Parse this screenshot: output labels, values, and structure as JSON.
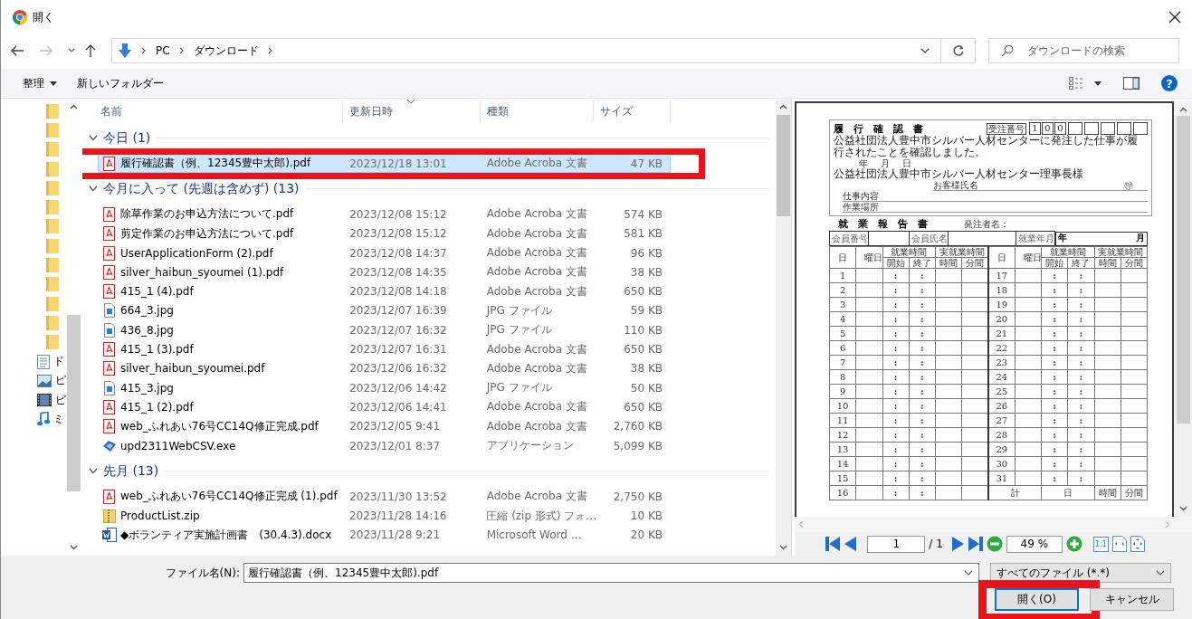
{
  "window": {
    "title": "開く"
  },
  "navigation": {
    "path": [
      "PC",
      "ダウンロード"
    ],
    "search": {
      "placeholder": "ダウンロードの検索"
    }
  },
  "toolbar": {
    "organize": "整理",
    "new_folder": "新しいフォルダー",
    "help": "?"
  },
  "nav_pane": {
    "items": [
      {
        "kind": "folder"
      },
      {
        "kind": "folder"
      },
      {
        "kind": "folder"
      },
      {
        "kind": "folder"
      },
      {
        "kind": "folder"
      },
      {
        "kind": "folder"
      },
      {
        "kind": "folder"
      },
      {
        "kind": "folder"
      },
      {
        "kind": "folder"
      },
      {
        "kind": "folder"
      },
      {
        "kind": "folder"
      },
      {
        "kind": "folder"
      },
      {
        "kind": "folder"
      },
      {
        "kind": "documents",
        "label": "ド"
      },
      {
        "kind": "pictures",
        "label": "ピ"
      },
      {
        "kind": "videos",
        "label": "ビ"
      },
      {
        "kind": "music",
        "label": "ミ"
      }
    ]
  },
  "file_list": {
    "columns": [
      {
        "label": "名前",
        "sorted": false
      },
      {
        "label": "更新日時",
        "sorted": true
      },
      {
        "label": "種類",
        "sorted": false
      },
      {
        "label": "サイズ",
        "sorted": false
      }
    ],
    "groups": [
      {
        "label": "今日 (1)",
        "expanded": true,
        "files": [
          {
            "kind": "pdf",
            "name": "履行確認書（例、12345豊中太郎).pdf",
            "modified": "2023/12/18 13:01",
            "type": "Adobe Acroba 文書",
            "size": "47 KB",
            "selected": true,
            "highlighted": true
          }
        ]
      },
      {
        "label": "今月に入って (先週は含めず) (13)",
        "expanded": true,
        "files": [
          {
            "kind": "pdf",
            "name": "除草作業のお申込方法について.pdf",
            "modified": "2023/12/08 15:12",
            "type": "Adobe Acroba 文書",
            "size": "574 KB",
            "selected": false,
            "highlighted": false
          },
          {
            "kind": "pdf",
            "name": "剪定作業のお申込方法について.pdf",
            "modified": "2023/12/08 15:12",
            "type": "Adobe Acroba 文書",
            "size": "581 KB",
            "selected": false,
            "highlighted": false
          },
          {
            "kind": "pdf",
            "name": "UserApplicationForm (2).pdf",
            "modified": "2023/12/08 14:37",
            "type": "Adobe Acroba 文書",
            "size": "96 KB",
            "selected": false,
            "highlighted": false
          },
          {
            "kind": "pdf",
            "name": "silver_haibun_syoumei (1).pdf",
            "modified": "2023/12/08 14:35",
            "type": "Adobe Acroba 文書",
            "size": "38 KB",
            "selected": false,
            "highlighted": false
          },
          {
            "kind": "pdf",
            "name": "415_1 (4).pdf",
            "modified": "2023/12/08 14:18",
            "type": "Adobe Acroba 文書",
            "size": "650 KB",
            "selected": false,
            "highlighted": false
          },
          {
            "kind": "jpg",
            "name": "664_3.jpg",
            "modified": "2023/12/07 16:39",
            "type": "JPG ファイル",
            "size": "59 KB",
            "selected": false,
            "highlighted": false
          },
          {
            "kind": "jpg",
            "name": "436_8.jpg",
            "modified": "2023/12/07 16:32",
            "type": "JPG ファイル",
            "size": "110 KB",
            "selected": false,
            "highlighted": false
          },
          {
            "kind": "pdf",
            "name": "415_1 (3).pdf",
            "modified": "2023/12/07 16:31",
            "type": "Adobe Acroba 文書",
            "size": "650 KB",
            "selected": false,
            "highlighted": false
          },
          {
            "kind": "pdf",
            "name": "silver_haibun_syoumei.pdf",
            "modified": "2023/12/06 16:32",
            "type": "Adobe Acroba 文書",
            "size": "38 KB",
            "selected": false,
            "highlighted": false
          },
          {
            "kind": "jpg",
            "name": "415_3.jpg",
            "modified": "2023/12/06 14:42",
            "type": "JPG ファイル",
            "size": "50 KB",
            "selected": false,
            "highlighted": false
          },
          {
            "kind": "pdf",
            "name": "415_1 (2).pdf",
            "modified": "2023/12/06 14:41",
            "type": "Adobe Acroba 文書",
            "size": "650 KB",
            "selected": false,
            "highlighted": false
          },
          {
            "kind": "pdf",
            "name": "web_ふれあい76号CC14Q修正完成.pdf",
            "modified": "2023/12/05 9:41",
            "type": "Adobe Acroba 文書",
            "size": "2,760 KB",
            "selected": false,
            "highlighted": false
          },
          {
            "kind": "exe",
            "name": "upd2311WebCSV.exe",
            "modified": "2023/12/01 8:37",
            "type": "アプリケーション",
            "size": "5,099 KB",
            "selected": false,
            "highlighted": false
          }
        ]
      },
      {
        "label": "先月 (13)",
        "expanded": true,
        "files": [
          {
            "kind": "pdf",
            "name": "web_ふれあい76号CC14Q修正完成 (1).pdf",
            "modified": "2023/11/30 13:52",
            "type": "Adobe Acroba 文書",
            "size": "2,750 KB",
            "selected": false,
            "highlighted": false
          },
          {
            "kind": "zip",
            "name": "ProductList.zip",
            "modified": "2023/11/28 14:16",
            "type": "圧縮 (zip 形式) フォ…",
            "size": "10 KB",
            "selected": false,
            "highlighted": false
          },
          {
            "kind": "docx",
            "name": "◆ボランティア実施計画書　(30.4.3).docx",
            "modified": "2023/11/28 9:21",
            "type": "Microsoft Word …",
            "size": "20 KB",
            "selected": false,
            "highlighted": false
          }
        ]
      }
    ]
  },
  "preview": {
    "document": {
      "title": "履　行　確　認　書",
      "order_label": "受注番号",
      "order_digits": [
        "1",
        "0",
        "0"
      ],
      "confirmation": "公益社団法人豊中市シルバー人材センターに発注した仕事が履行されたことを確認しました。",
      "date_parts": [
        "年",
        "月",
        "日"
      ],
      "addressee": "公益社団法人豊中市シルバー人材センター理事長様",
      "customer_label": "お客様氏名",
      "seal": "㊞",
      "work_label": "仕事内容",
      "place_label": "作業場所",
      "report_title": "就　業　報　告　書",
      "orderer_label": "発注者名：",
      "member_no_label": "会員番号",
      "member_name_label": "会員氏名",
      "work_month_label": "就業年月",
      "year": "年",
      "month": "月",
      "halves": [
        {
          "headers": {
            "day": "日",
            "weekday": "曜日",
            "work_time": "就業時間",
            "start": "開始",
            "end": "終了",
            "actual_time": "実就業時間",
            "hours": "時間",
            "minutes": "分間"
          },
          "rows": [
            {
              "day": "1",
              "start": ":",
              "end": ":"
            },
            {
              "day": "2",
              "start": ":",
              "end": ":"
            },
            {
              "day": "3",
              "start": ":",
              "end": ":"
            },
            {
              "day": "4",
              "start": ":",
              "end": ":"
            },
            {
              "day": "5",
              "start": ":",
              "end": ":"
            },
            {
              "day": "6",
              "start": ":",
              "end": ":"
            },
            {
              "day": "7",
              "start": ":",
              "end": ":"
            },
            {
              "day": "8",
              "start": ":",
              "end": ":"
            },
            {
              "day": "9",
              "start": ":",
              "end": ":"
            },
            {
              "day": "10",
              "start": ":",
              "end": ":"
            },
            {
              "day": "11",
              "start": ":",
              "end": ":"
            },
            {
              "day": "12",
              "start": ":",
              "end": ":"
            },
            {
              "day": "13",
              "start": ":",
              "end": ":"
            },
            {
              "day": "14",
              "start": ":",
              "end": ":"
            },
            {
              "day": "15",
              "start": ":",
              "end": ":"
            },
            {
              "day": "16",
              "start": ":",
              "end": ":"
            }
          ]
        },
        {
          "headers": {
            "day": "日",
            "weekday": "曜日",
            "work_time": "就業時間",
            "start": "開始",
            "end": "終了",
            "actual_time": "実就業時間",
            "hours": "時間",
            "minutes": "分間"
          },
          "rows": [
            {
              "day": "17",
              "start": ":",
              "end": ":"
            },
            {
              "day": "18",
              "start": ":",
              "end": ":"
            },
            {
              "day": "19",
              "start": ":",
              "end": ":"
            },
            {
              "day": "20",
              "start": ":",
              "end": ":"
            },
            {
              "day": "21",
              "start": ":",
              "end": ":"
            },
            {
              "day": "22",
              "start": ":",
              "end": ":"
            },
            {
              "day": "23",
              "start": ":",
              "end": ":"
            },
            {
              "day": "24",
              "start": ":",
              "end": ":"
            },
            {
              "day": "25",
              "start": ":",
              "end": ":"
            },
            {
              "day": "26",
              "start": ":",
              "end": ":"
            },
            {
              "day": "27",
              "start": ":",
              "end": ":"
            },
            {
              "day": "28",
              "start": ":",
              "end": ":"
            },
            {
              "day": "29",
              "start": ":",
              "end": ":"
            },
            {
              "day": "30",
              "start": ":",
              "end": ":"
            },
            {
              "day": "31",
              "start": ":",
              "end": ":"
            }
          ],
          "total": {
            "label": "計",
            "days": "日",
            "hours": "時間",
            "minutes": "分間"
          }
        }
      ]
    },
    "toolbar": {
      "page": "1",
      "page_total": "/ 1",
      "zoom": "49 %",
      "actual_size": "1:1"
    }
  },
  "footer": {
    "file_name_label": "ファイル名(N):",
    "file_name": "履行確認書（例、12345豊中太郎).pdf",
    "file_type": "すべてのファイル (*.*)",
    "buttons": [
      {
        "label": "開く(O)",
        "default": true,
        "highlighted": true
      },
      {
        "label": "キャンセル",
        "default": false,
        "highlighted": false
      }
    ]
  }
}
